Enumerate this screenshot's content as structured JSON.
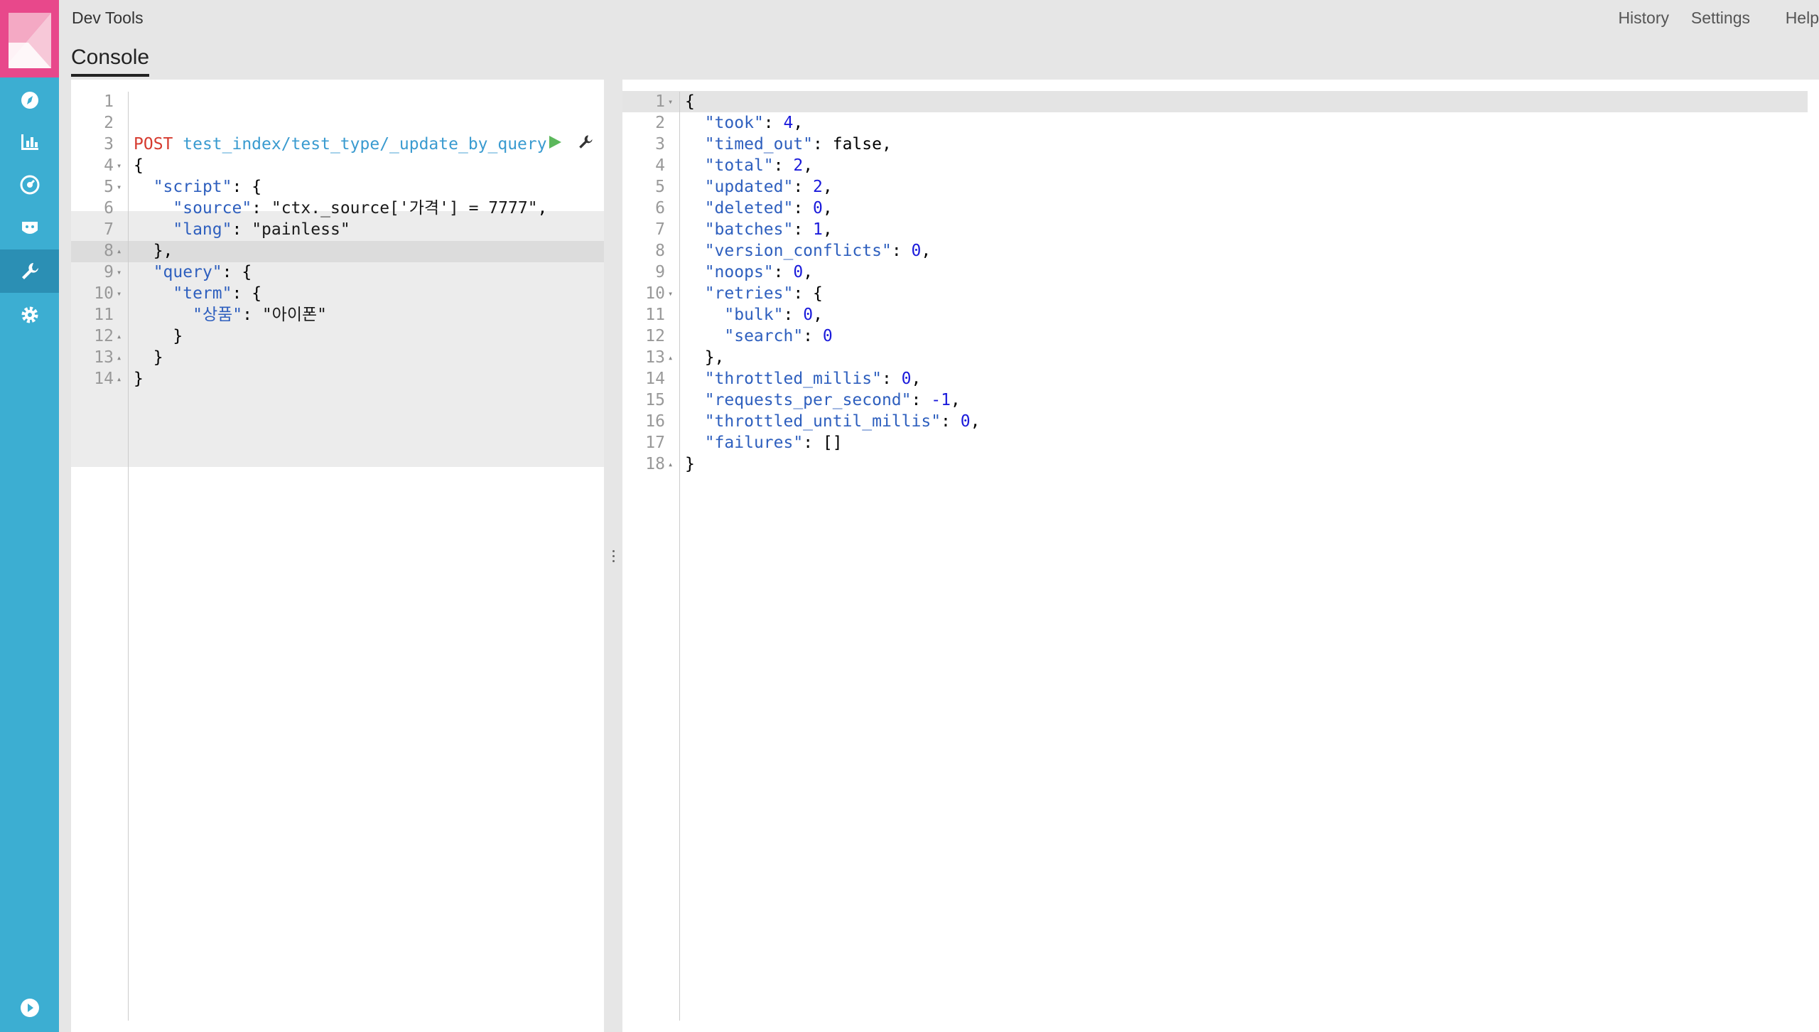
{
  "header": {
    "app_title": "Dev Tools",
    "links": [
      "History",
      "Settings",
      "Help"
    ],
    "tab": "Console"
  },
  "sidebar": {
    "icons": [
      "discover-icon",
      "visualize-icon",
      "dashboard-icon",
      "timelion-icon",
      "devtools-icon",
      "management-icon",
      "collapse-icon"
    ],
    "active": "devtools-icon",
    "colors": {
      "sidebar": "#3caed2",
      "logo": "#e8488b",
      "active": "#2b8fb4"
    }
  },
  "request": {
    "method": "POST",
    "url": "test_index/test_type/_update_by_query",
    "lines": [
      {
        "n": "1",
        "text": ""
      },
      {
        "n": "2",
        "text": ""
      },
      {
        "n": "3",
        "text": ""
      },
      {
        "n": "4",
        "text": "{"
      },
      {
        "n": "5",
        "text": "  \"script\": {"
      },
      {
        "n": "6",
        "text": "    \"source\": \"ctx._source['가격'] = 7777\","
      },
      {
        "n": "7",
        "text": "    \"lang\": \"painless\""
      },
      {
        "n": "8",
        "text": "  },"
      },
      {
        "n": "9",
        "text": "  \"query\": {"
      },
      {
        "n": "10",
        "text": "    \"term\": {"
      },
      {
        "n": "11",
        "text": "      \"상품\": \"아이폰\""
      },
      {
        "n": "12",
        "text": "    }"
      },
      {
        "n": "13",
        "text": "  }"
      },
      {
        "n": "14",
        "text": "}"
      }
    ]
  },
  "response": {
    "lines": [
      {
        "n": "1",
        "text": "{"
      },
      {
        "n": "2",
        "text": "  \"took\": 4,"
      },
      {
        "n": "3",
        "text": "  \"timed_out\": false,"
      },
      {
        "n": "4",
        "text": "  \"total\": 2,"
      },
      {
        "n": "5",
        "text": "  \"updated\": 2,"
      },
      {
        "n": "6",
        "text": "  \"deleted\": 0,"
      },
      {
        "n": "7",
        "text": "  \"batches\": 1,"
      },
      {
        "n": "8",
        "text": "  \"version_conflicts\": 0,"
      },
      {
        "n": "9",
        "text": "  \"noops\": 0,"
      },
      {
        "n": "10",
        "text": "  \"retries\": {"
      },
      {
        "n": "11",
        "text": "    \"bulk\": 0,"
      },
      {
        "n": "12",
        "text": "    \"search\": 0"
      },
      {
        "n": "13",
        "text": "  },"
      },
      {
        "n": "14",
        "text": "  \"throttled_millis\": 0,"
      },
      {
        "n": "15",
        "text": "  \"requests_per_second\": -1,"
      },
      {
        "n": "16",
        "text": "  \"throttled_until_millis\": 0,"
      },
      {
        "n": "17",
        "text": "  \"failures\": []"
      },
      {
        "n": "18",
        "text": "}"
      }
    ]
  }
}
